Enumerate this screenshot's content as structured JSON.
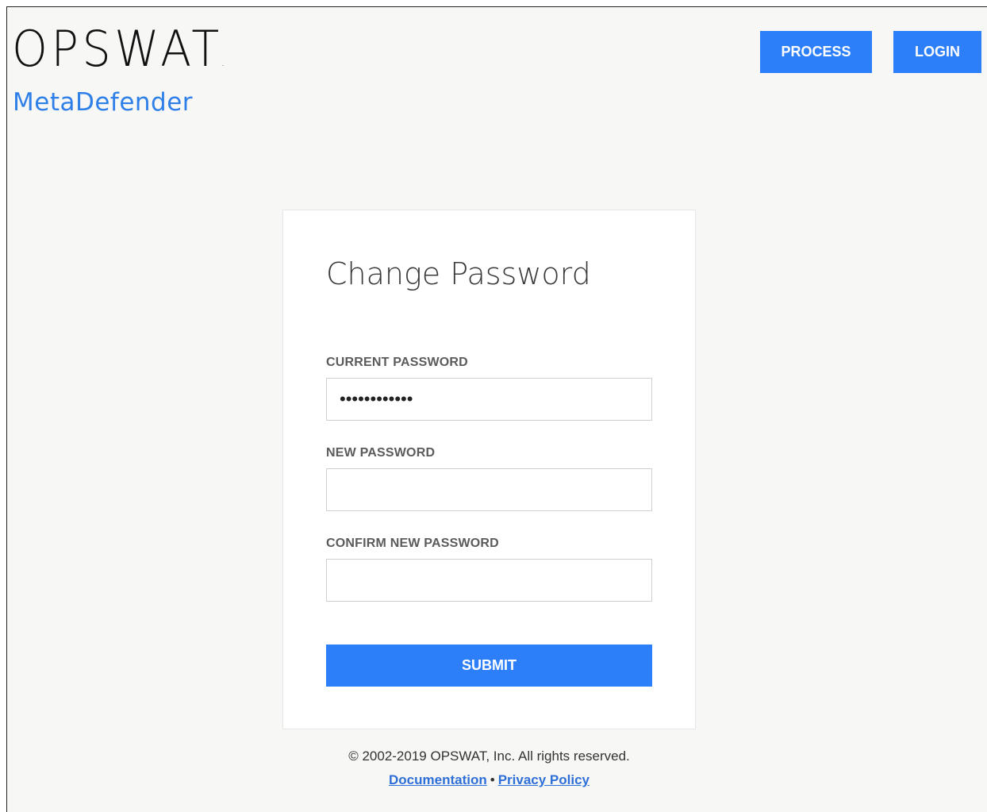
{
  "brand": {
    "logo_text": "OPSWAT",
    "logo_dot": ".",
    "product_name": "MetaDefender"
  },
  "nav": {
    "process_label": "PROCESS",
    "login_label": "LOGIN"
  },
  "form": {
    "title": "Change Password",
    "current_password_label": "CURRENT PASSWORD",
    "current_password_value": "••••••••••••",
    "new_password_label": "NEW PASSWORD",
    "new_password_value": "",
    "confirm_password_label": "CONFIRM NEW PASSWORD",
    "confirm_password_value": "",
    "submit_label": "SUBMIT"
  },
  "footer": {
    "copyright": "© 2002-2019 OPSWAT, Inc. All rights reserved.",
    "documentation_link": "Documentation",
    "separator": "•",
    "privacy_link": "Privacy Policy"
  },
  "colors": {
    "accent": "#2d7ff9",
    "product_text": "#2f7fe8",
    "page_background": "#f7f7f6"
  }
}
